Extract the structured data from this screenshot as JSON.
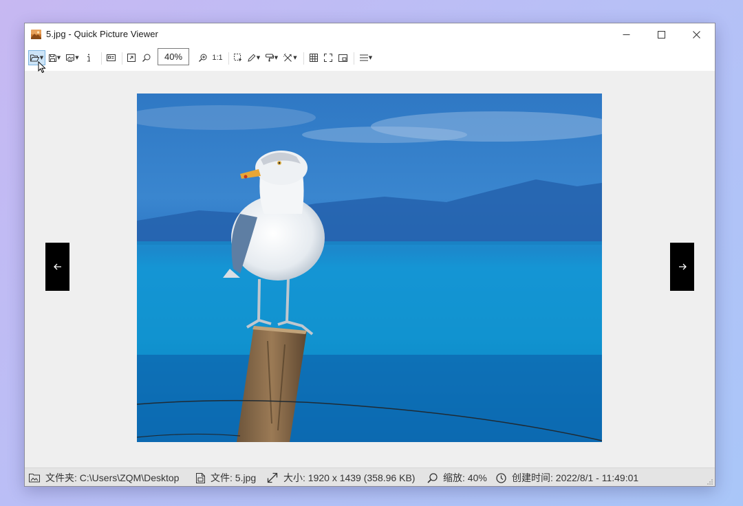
{
  "window": {
    "title": "5.jpg - Quick Picture Viewer"
  },
  "toolbar": {
    "zoom_value": "40%",
    "actual_size_label": "1:1"
  },
  "icons": {
    "open": "folder-open-icon",
    "save": "save-icon",
    "wallpaper": "picture-icon",
    "info": "info-icon",
    "properties": "card-icon",
    "autozoom": "fit-icon",
    "zoom_out": "zoom-out-icon",
    "zoom_in": "zoom-in-icon",
    "select": "selection-icon",
    "draw": "pencil-icon",
    "paint": "paint-icon",
    "tools": "tools-icon",
    "grid": "grid-icon",
    "fullscreen": "fullscreen-icon",
    "mini": "picture-in-picture-icon",
    "menu": "menu-icon"
  },
  "image": {
    "description": "seagull on post",
    "width": 1920,
    "height": 1439
  },
  "status": {
    "folder": "文件夹: C:\\Users\\ZQM\\Desktop",
    "file": "文件: 5.jpg",
    "size": "大小: 1920 x 1439 (358.96 KB)",
    "zoom": "缩放: 40%",
    "created": "创建时间: 2022/8/1 - 11:49:01"
  },
  "colors": {
    "accent": "#0078d4",
    "nav_bg": "#000000",
    "toolbar_bg": "#ffffff",
    "status_bg": "#e4e4e4"
  }
}
